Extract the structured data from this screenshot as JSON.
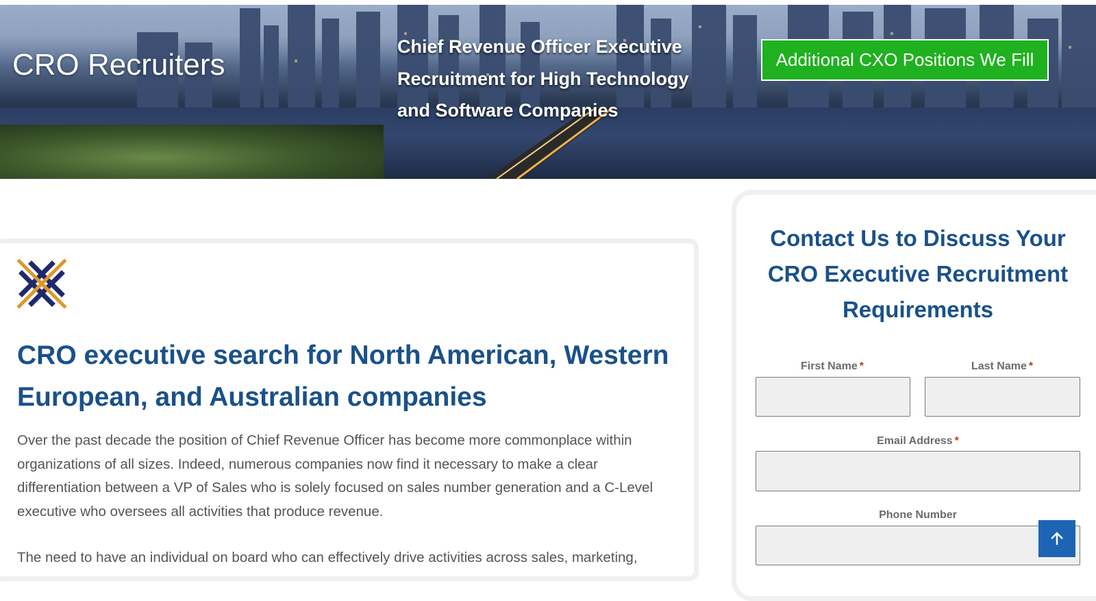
{
  "header": {
    "brand": "CRO Recruiters",
    "tagline": "Chief Revenue Officer Executive Recruitment for High Technology and Software Companies",
    "cta_label": "Additional CXO Positions We Fill"
  },
  "main": {
    "heading": "CRO executive search for North American, Western European, and Australian companies",
    "paragraphs": [
      "Over the past decade the position of Chief Revenue Officer has become more commonplace within organizations of all sizes. Indeed, numerous companies now find it necessary to make a clear differentiation between a VP of Sales who is solely focused on sales number generation and a C-Level executive who oversees all activities that produce revenue.",
      "The need to have an individual on board who can effectively drive activities across sales, marketing,"
    ]
  },
  "contact": {
    "heading": "Contact Us to Discuss Your CRO Executive Recruitment Requirements",
    "fields": {
      "first_name": {
        "label": "First Name",
        "required_mark": "*",
        "value": ""
      },
      "last_name": {
        "label": "Last Name",
        "required_mark": "*",
        "value": ""
      },
      "email": {
        "label": "Email Address",
        "required_mark": "*",
        "value": ""
      },
      "phone": {
        "label": "Phone Number",
        "value": ""
      }
    }
  },
  "colors": {
    "accent_blue": "#1a5189",
    "cta_green": "#1fb11f",
    "scroll_button": "#1e64b4",
    "required": "#c0392b"
  },
  "icons": {
    "logo": "crossed-bars-logo-icon",
    "scroll_top": "arrow-up-icon"
  }
}
